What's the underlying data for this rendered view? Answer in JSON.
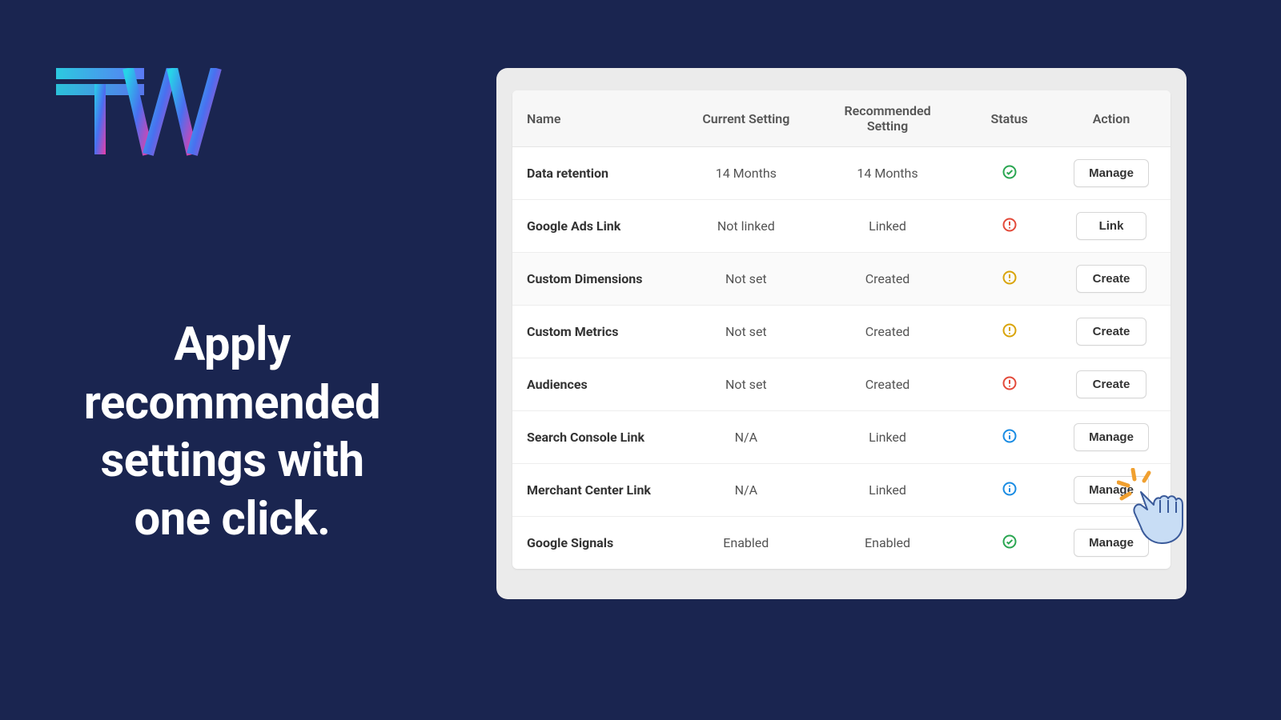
{
  "headline": "Apply recommended settings with one click.",
  "table": {
    "headers": {
      "name": "Name",
      "current": "Current Setting",
      "recommended": "Recommended Setting",
      "status": "Status",
      "action": "Action"
    },
    "rows": [
      {
        "name": "Data retention",
        "current": "14 Months",
        "recommended": "14 Months",
        "status": "success",
        "action": "Manage"
      },
      {
        "name": "Google Ads Link",
        "current": "Not linked",
        "recommended": "Linked",
        "status": "error",
        "action": "Link"
      },
      {
        "name": "Custom Dimensions",
        "current": "Not set",
        "recommended": "Created",
        "status": "warning",
        "action": "Create"
      },
      {
        "name": "Custom Metrics",
        "current": "Not set",
        "recommended": "Created",
        "status": "warning",
        "action": "Create"
      },
      {
        "name": "Audiences",
        "current": "Not set",
        "recommended": "Created",
        "status": "error",
        "action": "Create"
      },
      {
        "name": "Search Console Link",
        "current": "N/A",
        "recommended": "Linked",
        "status": "info",
        "action": "Manage"
      },
      {
        "name": "Merchant Center Link",
        "current": "N/A",
        "recommended": "Linked",
        "status": "info",
        "action": "Manage"
      },
      {
        "name": "Google Signals",
        "current": "Enabled",
        "recommended": "Enabled",
        "status": "success",
        "action": "Manage"
      }
    ]
  },
  "status_colors": {
    "success": "#2aa651",
    "error": "#e34a3a",
    "warning": "#d9a40a",
    "info": "#1a8ce3"
  }
}
